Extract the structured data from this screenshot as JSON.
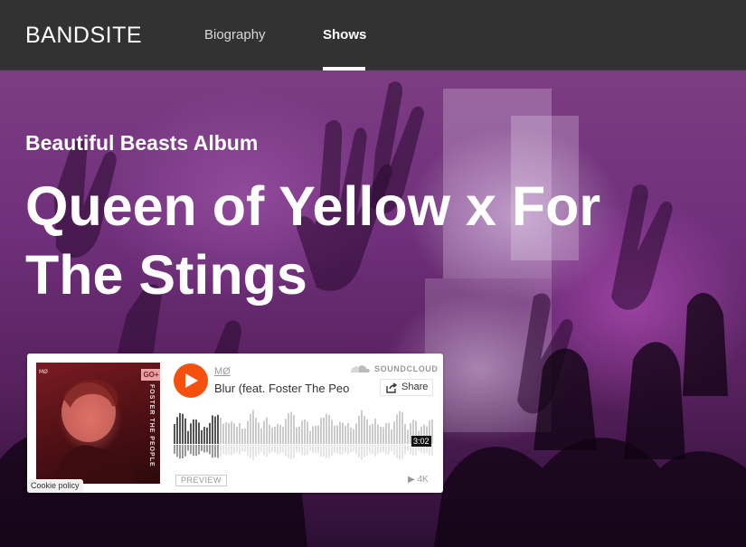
{
  "header": {
    "logo": "BANDSITE",
    "nav": [
      {
        "label": "Biography",
        "active": false
      },
      {
        "label": "Shows",
        "active": true
      }
    ]
  },
  "hero": {
    "subtitle": "Beautiful Beasts Album",
    "title": "Queen of Yellow x For The Stings"
  },
  "player": {
    "artist": "MØ",
    "track": "Blur (feat. Foster The People)",
    "brand": "SOUNDCLOUD",
    "share_label": "Share",
    "duration": "3:02",
    "preview_label": "PREVIEW",
    "plays": "4K",
    "cookie_label": "Cookie policy",
    "art_badge": "GO+",
    "art_text": "FOSTER THE PEOPLE",
    "progress": 0.17,
    "colors": {
      "play": "#f5500d",
      "played": "#555555",
      "unplayed": "#cccccc"
    }
  }
}
